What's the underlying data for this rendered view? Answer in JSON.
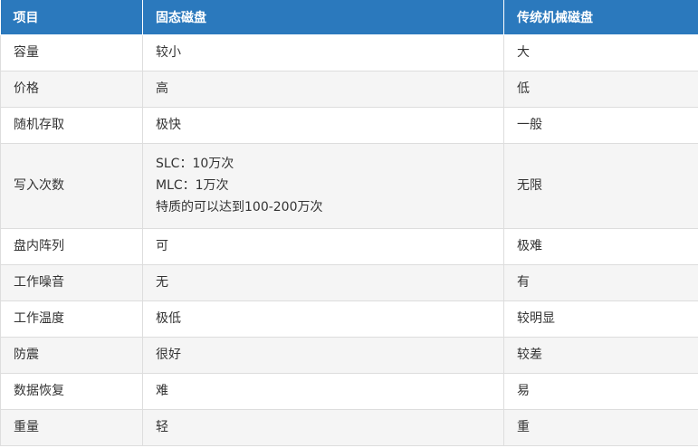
{
  "table": {
    "headers": [
      "项目",
      "固态磁盘",
      "传统机械磁盘"
    ],
    "rows": [
      {
        "item": "容量",
        "ssd": [
          "较小"
        ],
        "hdd": "大"
      },
      {
        "item": "价格",
        "ssd": [
          "高"
        ],
        "hdd": "低"
      },
      {
        "item": "随机存取",
        "ssd": [
          "极快"
        ],
        "hdd": "一般"
      },
      {
        "item": "写入次数",
        "ssd": [
          "SLC：10万次",
          "MLC：1万次",
          "特质的可以达到100-200万次"
        ],
        "hdd": "无限"
      },
      {
        "item": "盘内阵列",
        "ssd": [
          "可"
        ],
        "hdd": "极难"
      },
      {
        "item": "工作噪音",
        "ssd": [
          "无"
        ],
        "hdd": "有"
      },
      {
        "item": "工作温度",
        "ssd": [
          "极低"
        ],
        "hdd": "较明显"
      },
      {
        "item": "防震",
        "ssd": [
          "很好"
        ],
        "hdd": "较差"
      },
      {
        "item": "数据恢复",
        "ssd": [
          "难"
        ],
        "hdd": "易"
      },
      {
        "item": "重量",
        "ssd": [
          "轻"
        ],
        "hdd": "重"
      }
    ]
  },
  "colors": {
    "header_bg": "#2b79bd",
    "header_text": "#ffffff",
    "row_alt_bg": "#f5f5f5",
    "border": "#dddddd",
    "text": "#333333"
  }
}
